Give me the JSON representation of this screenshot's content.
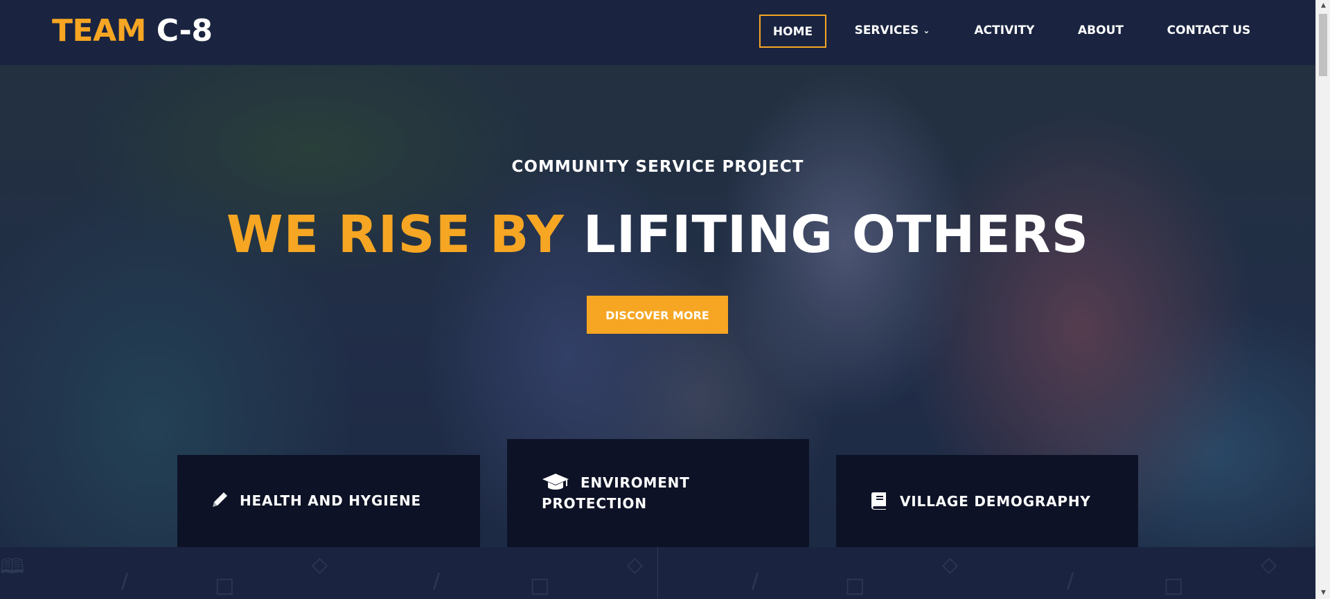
{
  "header": {
    "logo": {
      "part1": "TEAM",
      "part2": "C-8"
    },
    "nav": [
      {
        "label": "HOME",
        "active": true
      },
      {
        "label": "SERVICES",
        "dropdown": true
      },
      {
        "label": "ACTIVITY"
      },
      {
        "label": "ABOUT"
      },
      {
        "label": "CONTACT US"
      }
    ]
  },
  "hero": {
    "kicker": "COMMUNITY SERVICE PROJECT",
    "title_part1": "WE RISE BY",
    "title_part2": "LIFITING OTHERS",
    "cta_label": "DISCOVER MORE"
  },
  "features": [
    {
      "label": "HEALTH AND HYGIENE",
      "icon": "pencil-icon"
    },
    {
      "label": "ENVIROMENT PROTECTION",
      "icon": "graduation-cap-icon"
    },
    {
      "label": "VILLAGE DEMOGRAPHY",
      "icon": "book-icon"
    }
  ],
  "colors": {
    "accent": "#f6a623",
    "navy": "#1a2440",
    "box": "#0d1226"
  }
}
